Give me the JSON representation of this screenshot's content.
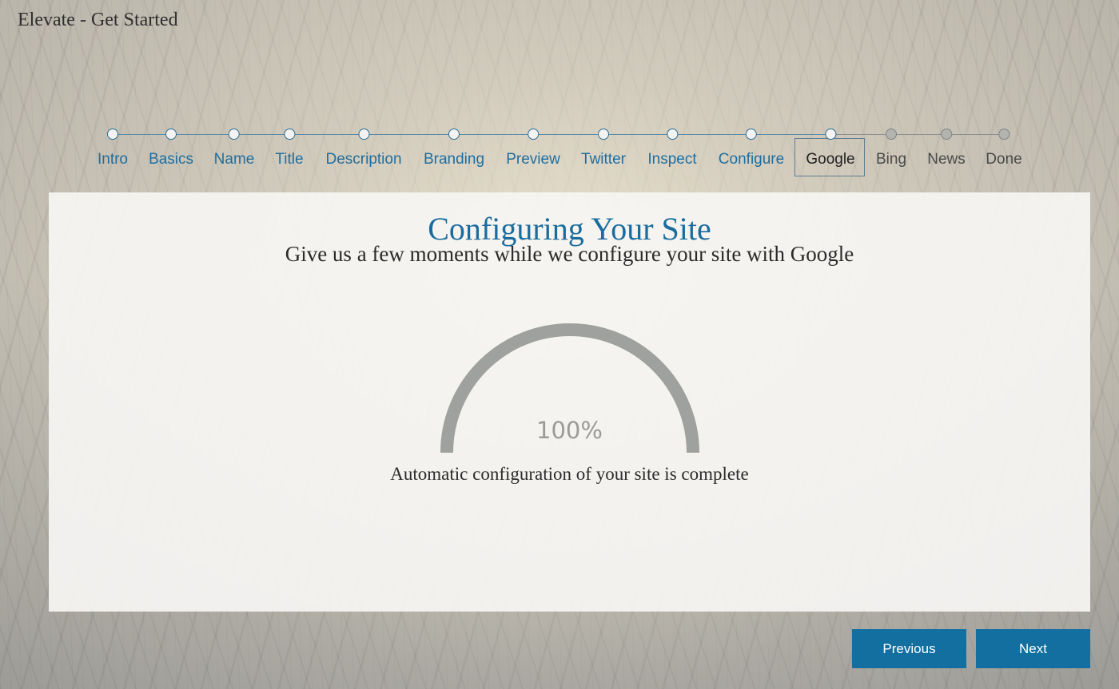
{
  "app": {
    "title": "Elevate - Get Started"
  },
  "stepper": {
    "current_index": 10,
    "steps": [
      {
        "label": "Intro"
      },
      {
        "label": "Basics"
      },
      {
        "label": "Name"
      },
      {
        "label": "Title"
      },
      {
        "label": "Description"
      },
      {
        "label": "Branding"
      },
      {
        "label": "Preview"
      },
      {
        "label": "Twitter"
      },
      {
        "label": "Inspect"
      },
      {
        "label": "Configure"
      },
      {
        "label": "Google"
      },
      {
        "label": "Bing"
      },
      {
        "label": "News"
      },
      {
        "label": "Done"
      }
    ]
  },
  "panel": {
    "title": "Configuring Your Site",
    "subtitle": "Give us a few moments while we configure your site with Google",
    "progress": {
      "value": 100,
      "label": "100%"
    },
    "status": "Automatic configuration of your site is complete"
  },
  "navigation": {
    "previous_label": "Previous",
    "next_label": "Next"
  },
  "colors": {
    "accent": "#136fa0",
    "gauge": "#9ea19d",
    "title": "#1a6c9e"
  }
}
